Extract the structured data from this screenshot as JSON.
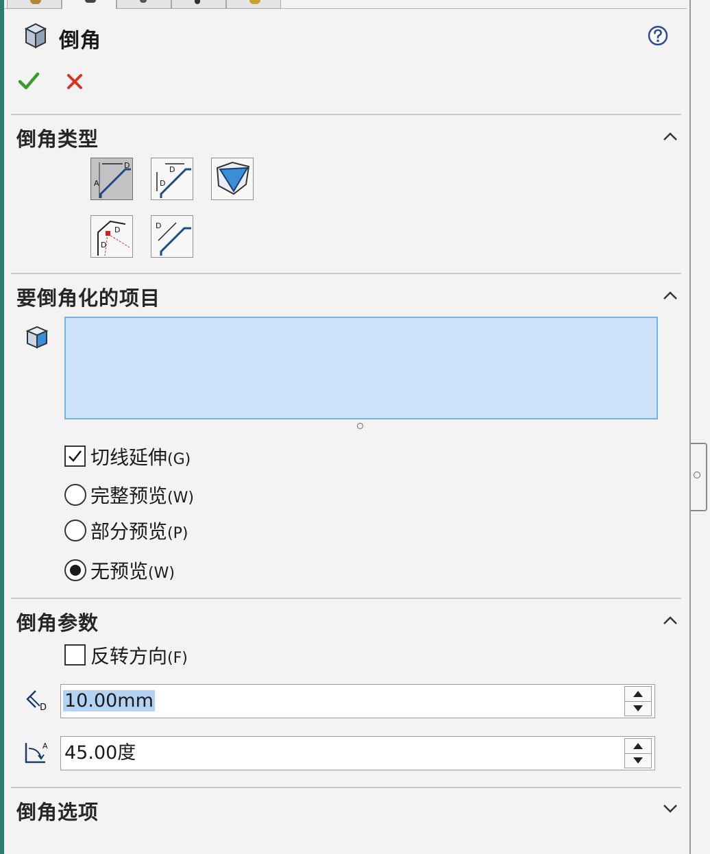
{
  "header": {
    "title": "倒角",
    "title_icon": "chamfer-feature-icon",
    "help_icon": "help-icon",
    "ok_icon": "checkmark-icon",
    "cancel_icon": "close-icon",
    "colors": {
      "ok": "#3a9a2a",
      "cancel": "#d9301f"
    }
  },
  "tabs": [
    {
      "icon": "feature-manager-icon",
      "active": false
    },
    {
      "icon": "property-manager-icon",
      "active": true
    },
    {
      "icon": "configuration-manager-icon",
      "active": false
    },
    {
      "icon": "dimxpert-manager-icon",
      "active": false
    },
    {
      "icon": "display-manager-icon",
      "active": false
    }
  ],
  "sections": {
    "type": {
      "title": "倒角类型",
      "expanded": true,
      "buttons": [
        {
          "icon": "angle-distance-chamfer-icon",
          "selected": true
        },
        {
          "icon": "distance-distance-chamfer-icon",
          "selected": false
        },
        {
          "icon": "vertex-chamfer-icon",
          "selected": false
        },
        {
          "icon": "offset-face-chamfer-icon",
          "selected": false
        },
        {
          "icon": "face-face-chamfer-icon",
          "selected": false
        }
      ]
    },
    "items": {
      "title": "要倒角化的项目",
      "expanded": true,
      "selection_icon": "edge-face-selection-icon",
      "options": {
        "tangent": {
          "label": "切线延伸",
          "accel": "(G)",
          "checked": true
        },
        "full_preview": {
          "label": "完整预览",
          "accel": "(W)",
          "selected": false
        },
        "partial_preview": {
          "label": "部分预览",
          "accel": "(P)",
          "selected": false
        },
        "no_preview": {
          "label": "无预览",
          "accel": "(W)",
          "selected": true
        }
      }
    },
    "params": {
      "title": "倒角参数",
      "expanded": true,
      "reverse": {
        "label": "反转方向",
        "accel": "(F)",
        "checked": false
      },
      "distance": {
        "value": "10.00mm",
        "icon": "distance-dimension-icon"
      },
      "angle": {
        "value": "45.00度",
        "icon": "angle-dimension-icon"
      }
    },
    "options": {
      "title": "倒角选项",
      "expanded": false
    }
  }
}
